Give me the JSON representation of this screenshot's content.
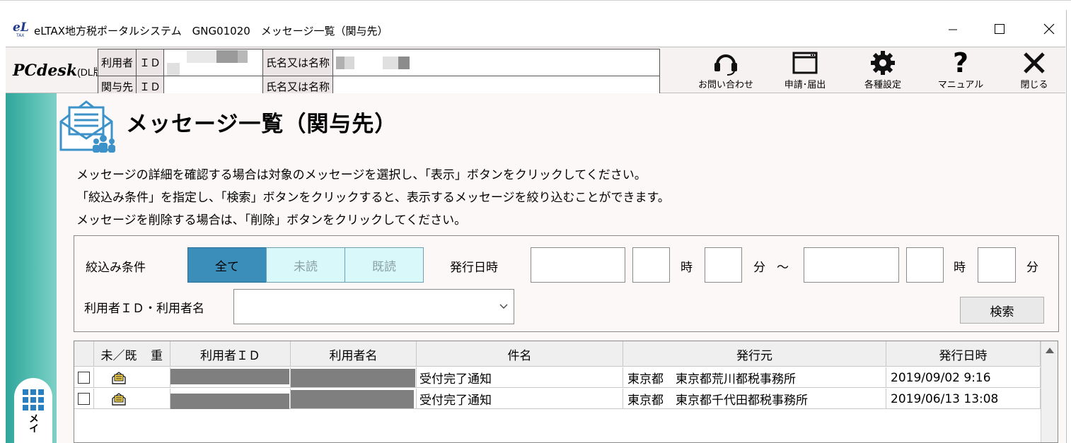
{
  "window": {
    "title": "eLTAX地方税ポータルシステム　GNG01020　メッセージ一覧（関与先）",
    "logo_icon": "eltax-logo-icon"
  },
  "header": {
    "brand": "PCdesk",
    "brand_sub": "(DL版)",
    "rows": [
      {
        "label1": "利用者",
        "label2": "ＩＤ",
        "label3": "氏名又は名称"
      },
      {
        "label1": "関与先",
        "label2": "ＩＤ",
        "label3": "氏名又は名称"
      }
    ],
    "tools": [
      {
        "label": "お問い合わせ",
        "icon": "headset-icon"
      },
      {
        "label": "申請･届出",
        "icon": "window-icon"
      },
      {
        "label": "各種設定",
        "icon": "gear-icon"
      },
      {
        "label": "マニュアル",
        "icon": "question-icon"
      },
      {
        "label": "閉じる",
        "icon": "close-icon"
      }
    ]
  },
  "page": {
    "title": "メッセージ一覧（関与先）",
    "instructions": [
      "メッセージの詳細を確認する場合は対象のメッセージを選択し、「表示」ボタンをクリックしてください。",
      "「絞込み条件」を指定し、「検索」ボタンをクリックすると、表示するメッセージを絞り込むことができます。",
      "メッセージを削除する場合は、「削除」ボタンをクリックしてください。"
    ]
  },
  "filter": {
    "label": "絞込み条件",
    "options": [
      "全て",
      "未読",
      "既読"
    ],
    "selected": "全て",
    "date_label": "発行日時",
    "hour_label": "時",
    "minute_label": "分",
    "range_sep": "～",
    "user_label": "利用者ＩＤ・利用者名",
    "search_label": "検索"
  },
  "table": {
    "columns": [
      "未／既",
      "重",
      "利用者ＩＤ",
      "利用者名",
      "件名",
      "発行元",
      "発行日時"
    ],
    "rows": [
      {
        "subject": "受付完了通知",
        "issuer": "東京都　東京都荒川都税事務所",
        "issued_at": "2019/09/02 9:16"
      },
      {
        "subject": "受付完了通知",
        "issuer": "東京都　東京都千代田都税事務所",
        "issued_at": "2019/06/13 13:08"
      }
    ]
  },
  "sidebar": {
    "menu_label": "メイ"
  },
  "colors": {
    "accent": "#3399cc",
    "sidebar": "#3fae9f",
    "unread_bg": "#d8f8fa"
  }
}
